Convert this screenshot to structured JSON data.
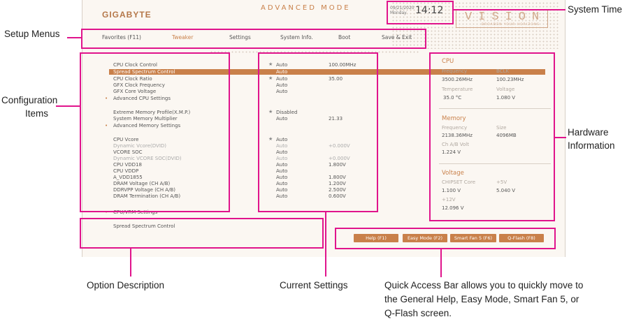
{
  "annotations": {
    "system_time": "System Time",
    "setup_menus": "Setup Menus",
    "config_items": [
      "Configuration",
      "Items"
    ],
    "hardware_info": [
      "Hardware",
      "Information"
    ],
    "option_description": "Option Description",
    "current_settings": "Current Settings",
    "quick_access": [
      "Quick Access Bar allows you to quickly move to",
      "the General Help, Easy Mode, Smart Fan 5, or",
      "Q-Flash screen."
    ]
  },
  "header": {
    "brand": "GIGABYTE",
    "mode": "ADVANCED MODE",
    "date": "09/21/2020",
    "day": "Monday",
    "time": "14:12",
    "vision": "VISION",
    "vision_tagline": "BROADEN YOUR HORIZONS"
  },
  "tabs": [
    "Favorites (F11)",
    "Tweaker",
    "Settings",
    "System Info.",
    "Boot",
    "Save & Exit"
  ],
  "active_tab": "Tweaker",
  "items": [
    {
      "label": "CPU Clock Control",
      "star": true,
      "value": "Auto",
      "extra": "100.00MHz"
    },
    {
      "label": "Spread Spectrum Control",
      "value": "Auto",
      "selected": true
    },
    {
      "label": "CPU Clock Ratio",
      "star": true,
      "value": "Auto",
      "extra": "35.00"
    },
    {
      "label": "GFX Clock Frequency",
      "value": "Auto"
    },
    {
      "label": "GFX Core Voltage",
      "value": "Auto"
    },
    {
      "label": "Advanced CPU Settings",
      "submenu": true
    },
    {
      "label": "Extreme Memory Profile(X.M.P.)",
      "star": true,
      "value": "Disabled"
    },
    {
      "label": "System Memory Multiplier",
      "value": "Auto",
      "extra": "21.33"
    },
    {
      "label": "Advanced Memory Settings",
      "submenu": true
    },
    {
      "label": "CPU Vcore",
      "star": true,
      "value": "Auto"
    },
    {
      "label": "Dynamic Vcore(DVID)",
      "value": "Auto",
      "extra": "+0.000V",
      "dim": true
    },
    {
      "label": "VCORE SOC",
      "value": "Auto"
    },
    {
      "label": "Dynamic VCORE SOC(DVID)",
      "value": "Auto",
      "extra": "+0.000V",
      "dim": true
    },
    {
      "label": "CPU VDD18",
      "value": "Auto",
      "extra": "1.800V"
    },
    {
      "label": "CPU VDDP",
      "value": "Auto"
    },
    {
      "label": "A_VDD1855",
      "value": "Auto",
      "extra": "1.800V"
    },
    {
      "label": "DRAM Voltage    (CH A/B)",
      "value": "Auto",
      "extra": "1.200V"
    },
    {
      "label": "DDRVPP Voltage  (CH A/B)",
      "value": "Auto",
      "extra": "2.500V"
    },
    {
      "label": "DRAM Termination  (CH A/B)",
      "value": "Auto",
      "extra": "0.600V"
    },
    {
      "label": "CPU/VRM Settings",
      "submenu": true
    }
  ],
  "description": "Spread Spectrum Control",
  "hardware": {
    "cpu_title": "CPU",
    "freq_label": "Frequency",
    "freq": "3500.26MHz",
    "bclk_label": "BCLK",
    "bclk": "100.23MHz",
    "temp_label": "Temperature",
    "temp": "35.0 °C",
    "volt_label": "Voltage",
    "volt": "1.080 V",
    "mem_title": "Memory",
    "mem_freq_label": "Frequency",
    "mem_freq": "2138.36MHz",
    "size_label": "Size",
    "size": "4096MB",
    "chab_label": "Ch A/B Volt",
    "chab": "1.224 V",
    "volt_title": "Voltage",
    "chipset_label": "CHIPSET Core",
    "chipset": "1.100 V",
    "v5_label": "+5V",
    "v5": "5.040 V",
    "v12_label": "+12V",
    "v12": "12.096 V"
  },
  "quick_buttons": [
    "Help (F1)",
    "Easy Mode (F2)",
    "Smart Fan 5 (F6)",
    "Q-Flash (F8)"
  ]
}
